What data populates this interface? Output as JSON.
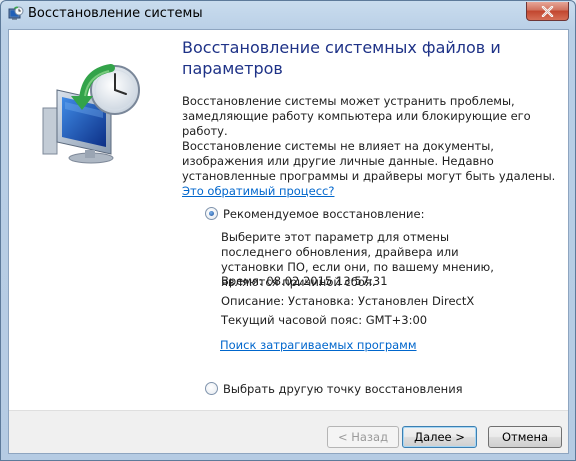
{
  "window": {
    "title": "Восстановление системы"
  },
  "heading": "Восстановление системных файлов и параметров",
  "intro": "Восстановление системы может устранить проблемы, замедляющие работу компьютера или блокирующие его работу.",
  "info": {
    "text": "Восстановление системы не влияет на документы, изображения или другие личные данные. Недавно установленные программы и драйверы могут быть удалены.",
    "link": "Это обратимый процесс?"
  },
  "options": {
    "recommended": {
      "label": "Рекомендуемое восстановление:",
      "selected": true,
      "description": "Выберите этот параметр для отмены последнего обновления, драйвера или установки ПО, если они, по вашему мнению, являются причиной сбоя.",
      "time": "Время: 08.02.2015 13:57:31",
      "desc": "Описание: Установка: Установлен DirectX",
      "timezone": "Текущий часовой пояс: GMT+3:00",
      "scan_link": "Поиск затрагиваемых программ"
    },
    "other": {
      "label": "Выбрать другую точку восстановления",
      "selected": false
    }
  },
  "buttons": {
    "back": "< Назад",
    "next": "Далее >",
    "cancel": "Отмена"
  },
  "icons": {
    "title": "system-restore-icon",
    "hero": "system-restore-monitor-clock-icon",
    "close": "close-icon"
  },
  "colors": {
    "heading": "#1e3287",
    "link": "#0066cc",
    "close": "#c2462f"
  }
}
